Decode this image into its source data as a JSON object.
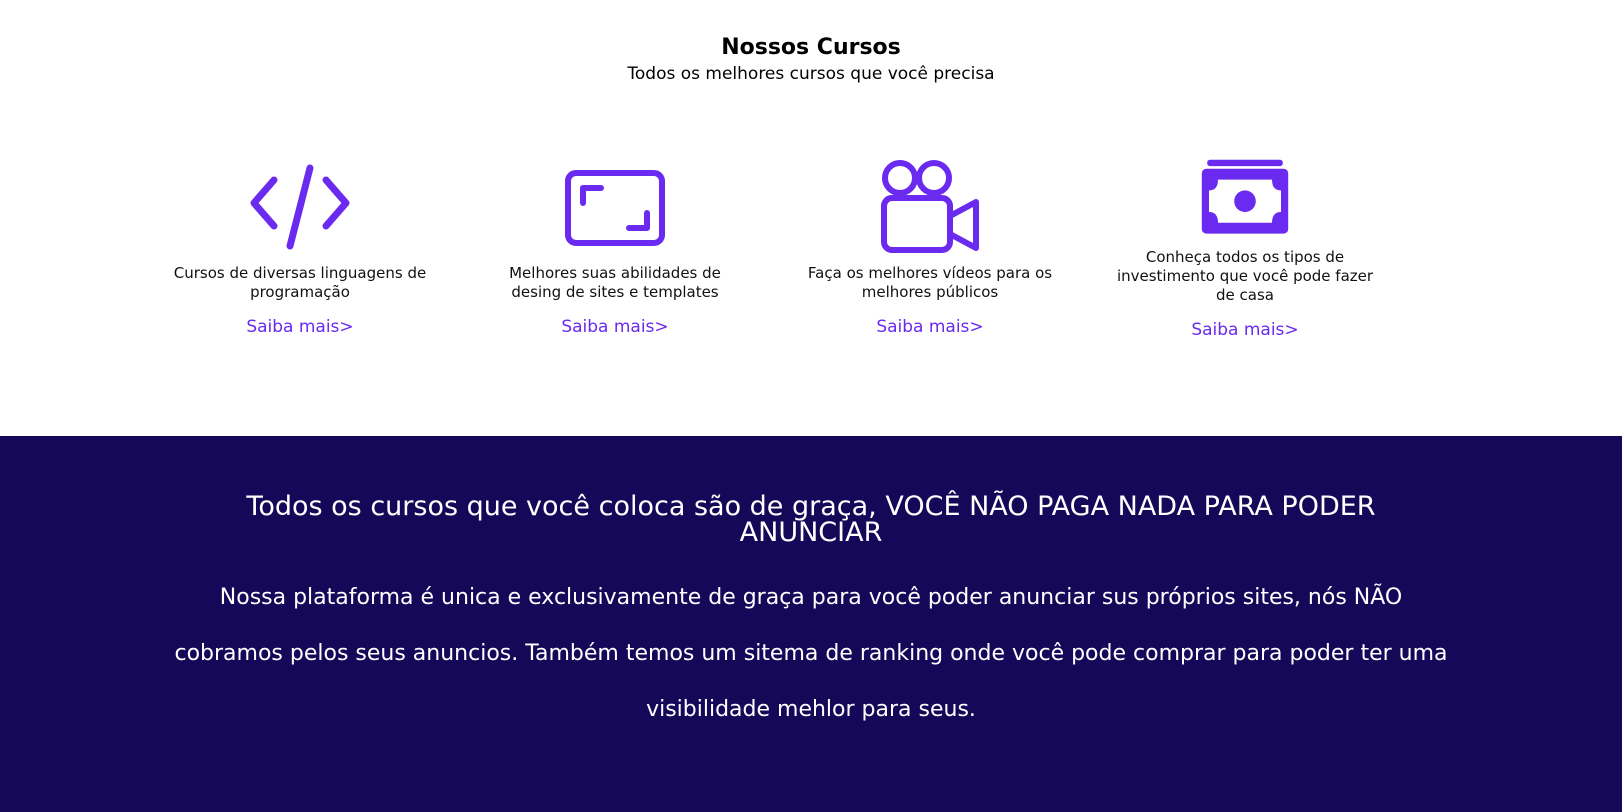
{
  "courses": {
    "title": "Nossos Cursos",
    "subtitle": "Todos os melhores cursos que você precisa",
    "accent_color": "#6a2af0",
    "cards": [
      {
        "icon": "code-icon",
        "description": "Cursos de diversas linguagens de programação",
        "link": "Saiba mais>"
      },
      {
        "icon": "fullscreen-frame-icon",
        "description": "Melhores suas abilidades de desing de sites e templates",
        "link": "Saiba mais>"
      },
      {
        "icon": "video-camera-icon",
        "description": "Faça os melhores vídeos para os melhores públicos",
        "link": "Saiba mais>"
      },
      {
        "icon": "money-bill-icon",
        "description": "Conheça todos os tipos de investimento que você pode fazer de casa",
        "link": "Saiba mais>"
      }
    ]
  },
  "banner": {
    "background_color": "#150858",
    "heading": "Todos os cursos que você coloca são de graça, VOCÊ NÃO PAGA NADA PARA PODER ANUNCIAR",
    "text": "Nossa plataforma é unica e exclusivamente de graça para você poder anunciar sus próprios sites, nós NÃO cobramos pelos seus anuncios. Também temos um sitema de ranking onde você pode comprar para poder ter uma visibilidade mehlor para seus."
  }
}
